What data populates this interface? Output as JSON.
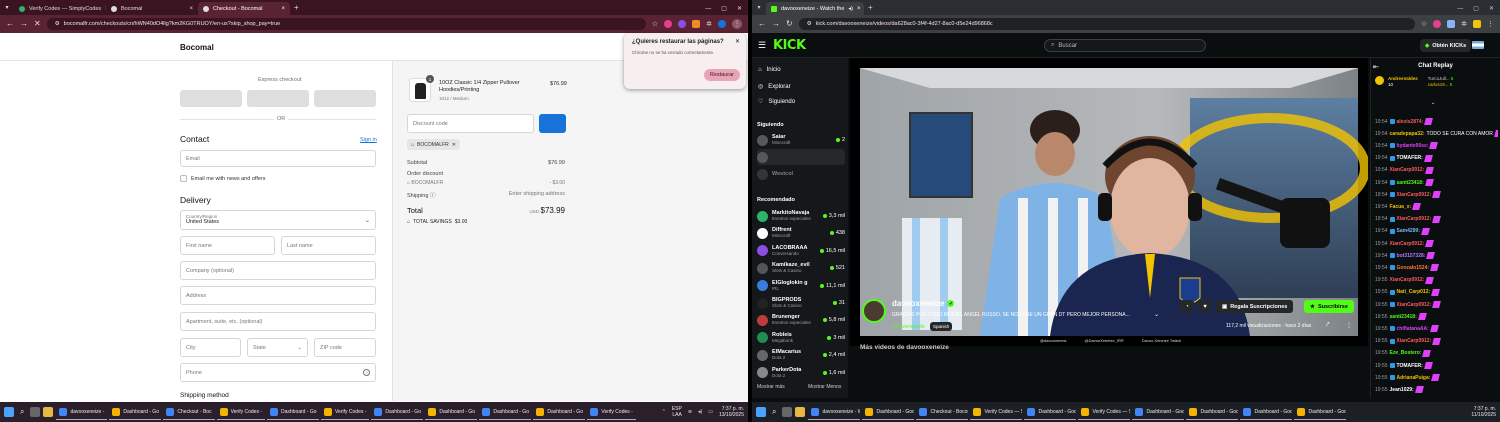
{
  "left": {
    "tabs": [
      {
        "label": "Verify Codes — SimplyCodes",
        "color": "#2fb36b"
      },
      {
        "label": "Bocomal",
        "color": "#dddddd"
      },
      {
        "label": "Checkout - Bocomal",
        "color": "#dddddd"
      }
    ],
    "url": "bocomalfr.com/checkouts/cn/hWN40dO4llg?km2KG0TRUOY/en-us?skip_shop_pay=true",
    "brand": "Bocomal",
    "express_checkout": "Express checkout",
    "or": "OR",
    "contact": {
      "title": "Contact",
      "sign_in": "Sign in",
      "email_placeholder": "Email",
      "newsletter": "Email me with news and offers"
    },
    "delivery": {
      "title": "Delivery",
      "country_label": "Country/Region",
      "country_value": "United States",
      "first_name": "First name",
      "last_name": "Last name",
      "company": "Company (optional)",
      "address": "Address",
      "apartment": "Apartment, suite, etc. (optional)",
      "city": "City",
      "state": "State",
      "zip": "ZIP code",
      "phone": "Phone"
    },
    "shipping_method": "Shipping method",
    "summary": {
      "product_name": "10OZ Classic 1/4 Zipper Pullover Hoodies/Printing",
      "product_variant": "1012 / Medium",
      "product_qty": "1",
      "product_price": "$76.99",
      "discount_placeholder": "Discount code",
      "discount_tag": "BOCOMALFR",
      "subtotal_label": "Subtotal",
      "subtotal_value": "$76.99",
      "order_discount_label": "Order discount",
      "discount_code": "BOCOMALFR",
      "discount_value": "- $3.00",
      "shipping_label": "Shipping",
      "shipping_value": "Enter shipping address",
      "total_label": "Total",
      "total_currency": "USD",
      "total_value": "$73.99",
      "savings_label": "TOTAL SAVINGS",
      "savings_value": "$3.00"
    },
    "popup": {
      "title": "¿Quieres restaurar las páginas?",
      "body": "Chrome no se ha cerrado correctamente.",
      "button": "Restaurar"
    },
    "taskbar": {
      "items": [
        "davooxeneize -",
        "Dashboard - Go",
        "Checkout - Boc",
        "Verify Codes -",
        "Dashboard - Go",
        "Verify Codes -",
        "Dashboard - Go",
        "Dashboard - Go",
        "Dashboard - Go",
        "Dashboard - Go",
        "Verify Codes -"
      ],
      "lang1": "ESP",
      "lang2": "LAA",
      "time": "7:37 p. m.",
      "date": "13/10/2025"
    }
  },
  "right": {
    "tab_label": "davooxeneize - Watch the",
    "url": "kick.com/davooxeneize/videos/da628ac0-3f4f-4d27-8ac0-d5e24d96868c",
    "search_placeholder": "Buscar",
    "get_kicks": "Obtén KICKs",
    "nav": [
      "Inicio",
      "Explorar",
      "Siguiendo"
    ],
    "following_title": "Siguiendo",
    "following": [
      {
        "name": "Saiar",
        "cat": "Minecraft",
        "count": "2"
      },
      {
        "name": "",
        "cat": "",
        "count": ""
      },
      {
        "name": "Westcol",
        "cat": "",
        "count": ""
      }
    ],
    "recommended_title": "Recomendado",
    "recommended": [
      {
        "name": "MarkitoNavaja",
        "cat": "Eventos especiales",
        "count": "3,3 mil"
      },
      {
        "name": "Diffrent",
        "cat": "Minecraft",
        "count": "438"
      },
      {
        "name": "LACOBRAAA",
        "cat": "Conversando",
        "count": "16,5 mil"
      },
      {
        "name": "Kamikaze_evil",
        "cat": "Slots & Casino",
        "count": "521"
      },
      {
        "name": "ElGloglokin g",
        "cat": "IRL",
        "count": "11,1 mil"
      },
      {
        "name": "BIGPRODS",
        "cat": "Slots & Casino",
        "count": "31"
      },
      {
        "name": "Brunenger",
        "cat": "Eventos especiales",
        "count": "5,8 mil"
      },
      {
        "name": "Robleis",
        "cat": "Megabonk",
        "count": "3 mil"
      },
      {
        "name": "ElMacarius",
        "cat": "Dota 2",
        "count": "2,4 mil"
      },
      {
        "name": "ParkerDota",
        "cat": "Dota 2",
        "count": "1,6 mil"
      }
    ],
    "show_more": "Mostrar más",
    "show_less": "Mostrar Menos",
    "streamer": {
      "name": "davooxeneize",
      "title": "GRACIAS POR TODO MIGUEL ANGEL RUSSO. SE NOS FUE UN GRAN DT PERO MEJOR PERSONA...",
      "category": "Conversando",
      "language": "Spanish",
      "views": "117,2 mil visualizaciones",
      "ago": "hace 2 días",
      "subs_button": "Regala Suscripciones",
      "subscribe": "Suscribirse",
      "more_videos": "Más videos de davooxeneize"
    },
    "overlay": [
      "@davooxeneiz",
      "@DavooXeneize_IRR",
      "Davoo Xeneize Twitch"
    ],
    "chat": {
      "title": "Chat Replay",
      "pinned": [
        {
          "user": "AndresValdes",
          "msg": "10"
        },
        {
          "user": "TurcoJull...",
          "msg": "5"
        },
        {
          "user": "carlos19...",
          "msg": "5"
        }
      ],
      "messages": [
        {
          "time": "19:54",
          "user": "alexis2874:",
          "msg": "",
          "color": "#ff5a5a"
        },
        {
          "time": "19:54",
          "user": "caradepapa32:",
          "msg": "TODO SE CURA CON AMOR",
          "color": "#f0c000"
        },
        {
          "time": "19:54",
          "user": "bydante90ss:",
          "msg": "",
          "color": "#e040fb"
        },
        {
          "time": "19:54",
          "user": "TOMAFER:",
          "msg": "",
          "color": "#ffffff"
        },
        {
          "time": "19:54",
          "user": "XianCarp0912:",
          "msg": "",
          "color": "#ff5a5a"
        },
        {
          "time": "19:54",
          "user": "santi23418:",
          "msg": "",
          "color": "#53fc18"
        },
        {
          "time": "19:54",
          "user": "XianCarp0912:",
          "msg": "",
          "color": "#ff5a5a"
        },
        {
          "time": "19:54",
          "user": "Facua_x:",
          "msg": "",
          "color": "#f0c000"
        },
        {
          "time": "19:54",
          "user": "XianCarp0912:",
          "msg": "",
          "color": "#ff5a5a"
        },
        {
          "time": "19:54",
          "user": "Sam4299:",
          "msg": "",
          "color": "#7ab8ff"
        },
        {
          "time": "19:54",
          "user": "XianCarp0912:",
          "msg": "",
          "color": "#ff5a5a"
        },
        {
          "time": "19:54",
          "user": "bot3157328:",
          "msg": "",
          "color": "#b07aff"
        },
        {
          "time": "19:54",
          "user": "Gonzalo1524:",
          "msg": "",
          "color": "#ff7a3a"
        },
        {
          "time": "19:55",
          "user": "XianCarp0912:",
          "msg": "",
          "color": "#ff5a5a"
        },
        {
          "time": "19:55",
          "user": "Nati_Carp012:",
          "msg": "",
          "color": "#f0c000"
        },
        {
          "time": "19:55",
          "user": "XianCarp0912:",
          "msg": "",
          "color": "#ff5a5a"
        },
        {
          "time": "19:55",
          "user": "santi23418:",
          "msg": "",
          "color": "#53fc18"
        },
        {
          "time": "19:55",
          "user": "chiflatanaAA:",
          "msg": "",
          "color": "#e040fb"
        },
        {
          "time": "19:55",
          "user": "XianCarp0912:",
          "msg": "",
          "color": "#ff5a5a"
        },
        {
          "time": "19:55",
          "user": "Eze_Bostero:",
          "msg": "",
          "color": "#53fc18"
        },
        {
          "time": "19:55",
          "user": "TOMAFER:",
          "msg": "",
          "color": "#ffffff"
        },
        {
          "time": "19:55",
          "user": "AdrianaPuiga:",
          "msg": "",
          "color": "#f0c000"
        },
        {
          "time": "19:55",
          "user": "Jean1029:",
          "msg": "",
          "color": "#ffffff"
        }
      ]
    },
    "taskbar": {
      "items": [
        "davooxeneize - W",
        "Dashboard - Goo",
        "Checkout - Bocom",
        "Verify Codes — Si",
        "Dashboard - Goo",
        "Verify Codes — Si",
        "Dashboard - Goo",
        "Dashboard - Goo",
        "Dashboard - Goo",
        "Dashboard - Goo"
      ],
      "time": "7:37 p. m.",
      "date": "11/10/2025"
    }
  },
  "colors": {
    "kick_green": "#53fc18",
    "chrome_dark": "#3a1420",
    "chrome_mid": "#5a2334",
    "pay_blue": "#1773d9"
  }
}
